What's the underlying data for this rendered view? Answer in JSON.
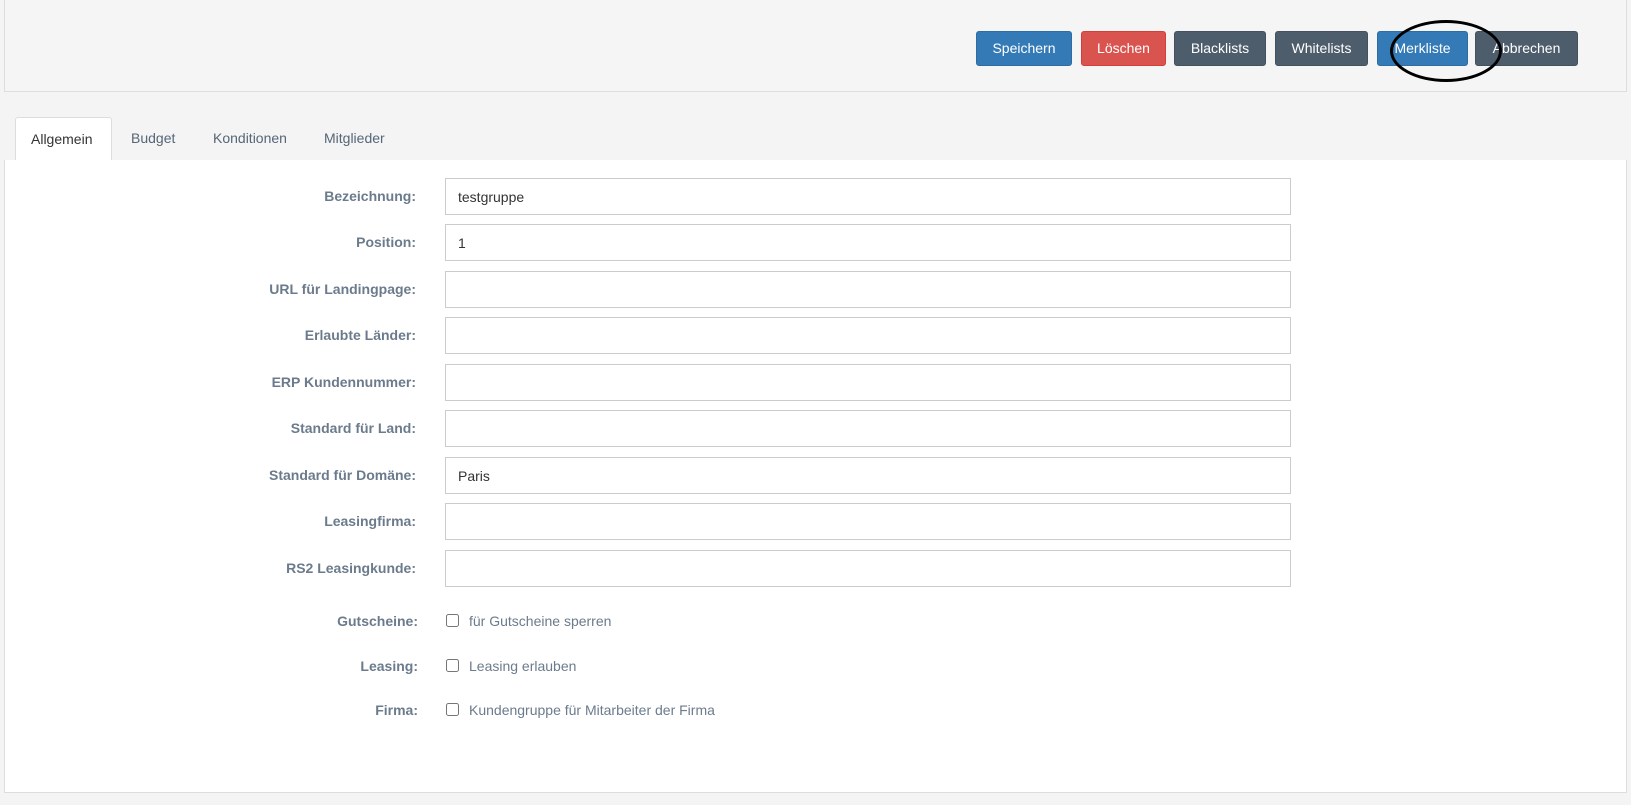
{
  "toolbar": {
    "save_label": "Speichern",
    "delete_label": "Löschen",
    "blacklists_label": "Blacklists",
    "whitelists_label": "Whitelists",
    "merkliste_label": "Merkliste",
    "cancel_label": "Abbrechen"
  },
  "colors": {
    "primary": "#337ab7",
    "danger": "#d9534f",
    "dark": "#4e5d6c",
    "label": "#6b7b8c"
  },
  "tabs": [
    {
      "label": "Allgemein",
      "active": true
    },
    {
      "label": "Budget",
      "active": false
    },
    {
      "label": "Konditionen",
      "active": false
    },
    {
      "label": "Mitglieder",
      "active": false
    }
  ],
  "form": {
    "fields": [
      {
        "label": "Bezeichnung:",
        "value": "testgruppe"
      },
      {
        "label": "Position:",
        "value": "1"
      },
      {
        "label": "URL für Landingpage:",
        "value": ""
      },
      {
        "label": "Erlaubte Länder:",
        "value": ""
      },
      {
        "label": "ERP Kundennummer:",
        "value": ""
      },
      {
        "label": "Standard für Land:",
        "value": ""
      },
      {
        "label": "Standard für Domäne:",
        "value": "Paris"
      },
      {
        "label": "Leasingfirma:",
        "value": ""
      },
      {
        "label": "RS2 Leasingkunde:",
        "value": ""
      }
    ],
    "checkboxes": [
      {
        "label": "Gutscheine:",
        "text": "für Gutscheine sperren",
        "checked": false
      },
      {
        "label": "Leasing:",
        "text": "Leasing erlauben",
        "checked": false
      },
      {
        "label": "Firma:",
        "text": "Kundengruppe für Mitarbeiter der Firma",
        "checked": false
      }
    ]
  }
}
